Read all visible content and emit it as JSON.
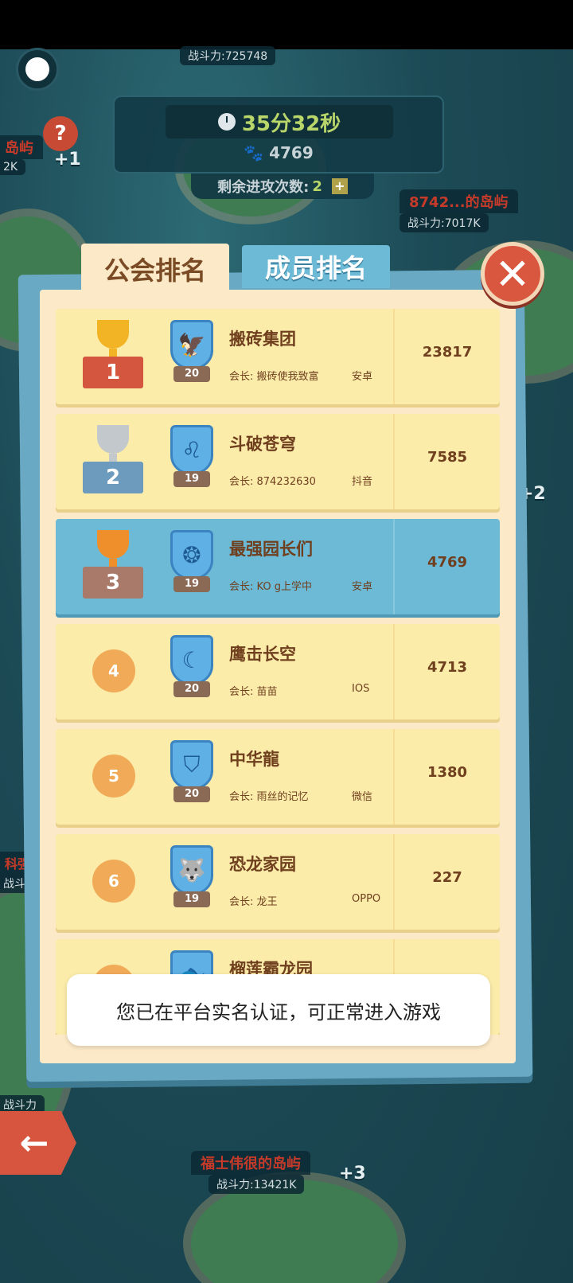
{
  "map": {
    "top_power": "战斗力:725748",
    "timer": "35分32秒",
    "paw_count": "4769",
    "attacks_label": "剩余进攻次数:",
    "attacks_value": "2",
    "left_enemy_partial": "岛屿",
    "left_enemy_power_partial": "2K",
    "left_plus": "+1",
    "right_enemy_name": "8742...的岛屿",
    "right_enemy_power": "战斗力:7017K",
    "right_plus_mid": "+2",
    "left_enemy2_name": "科强",
    "left_enemy2_power": "战斗力",
    "left_enemy3_power": "战斗力",
    "bottom_enemy_name": "福士伟很的岛屿",
    "bottom_enemy_power": "战斗力:13421K",
    "bottom_plus": "+3",
    "back_arrow": "←"
  },
  "dialog": {
    "tabs": [
      {
        "label": "公会排名",
        "active": true
      },
      {
        "label": "成员排名",
        "active": false
      }
    ],
    "close_symbol": "✕",
    "rows": [
      {
        "rank": "1",
        "trophy": "gold",
        "level": "20",
        "emblem_icon": "eagle-icon",
        "emblem_glyph": "🦅",
        "name": "搬砖集团",
        "leader": "会长: 搬砖使我致富",
        "platform": "安卓",
        "score": "23817"
      },
      {
        "rank": "2",
        "trophy": "silver",
        "level": "19",
        "emblem_icon": "lion-icon",
        "emblem_glyph": "♌",
        "name": "斗破苍穹",
        "leader": "会长: 874232630",
        "platform": "抖音",
        "score": "7585"
      },
      {
        "rank": "3",
        "trophy": "bronze",
        "level": "19",
        "emblem_icon": "seahorse-icon",
        "emblem_glyph": "❂",
        "name": "最强园长们",
        "leader": "会长: KO g上学中",
        "platform": "安卓",
        "score": "4769"
      },
      {
        "rank": "4",
        "trophy": "none",
        "level": "20",
        "emblem_icon": "moon-icon",
        "emblem_glyph": "☾",
        "name": "鹰击长空",
        "leader": "会长: 苗苗",
        "platform": "IOS",
        "score": "4713"
      },
      {
        "rank": "5",
        "trophy": "none",
        "level": "20",
        "emblem_icon": "shield-crest-icon",
        "emblem_glyph": "⛉",
        "name": "中华龍",
        "leader": "会长: 雨丝的记忆",
        "platform": "微信",
        "score": "1380"
      },
      {
        "rank": "6",
        "trophy": "none",
        "level": "19",
        "emblem_icon": "wolf-icon",
        "emblem_glyph": "🐺",
        "name": "恐龙家园",
        "leader": "会长: 龙王",
        "platform": "OPPO",
        "score": "227"
      },
      {
        "rank": "",
        "trophy": "none",
        "level": "",
        "emblem_icon": "fish-icon",
        "emblem_glyph": "🐟",
        "name": "榴莲霸龙园",
        "leader": "",
        "platform": "",
        "score": ""
      }
    ]
  },
  "toast": "您已在平台实名认证，可正常进入游戏",
  "colors": {
    "panel_bg": "#fbe9c7",
    "row_bg": "#fcecaa",
    "row_highlight": "#6cbad6",
    "accent_red": "#d9563f",
    "tab_inactive": "#6dbad6"
  }
}
